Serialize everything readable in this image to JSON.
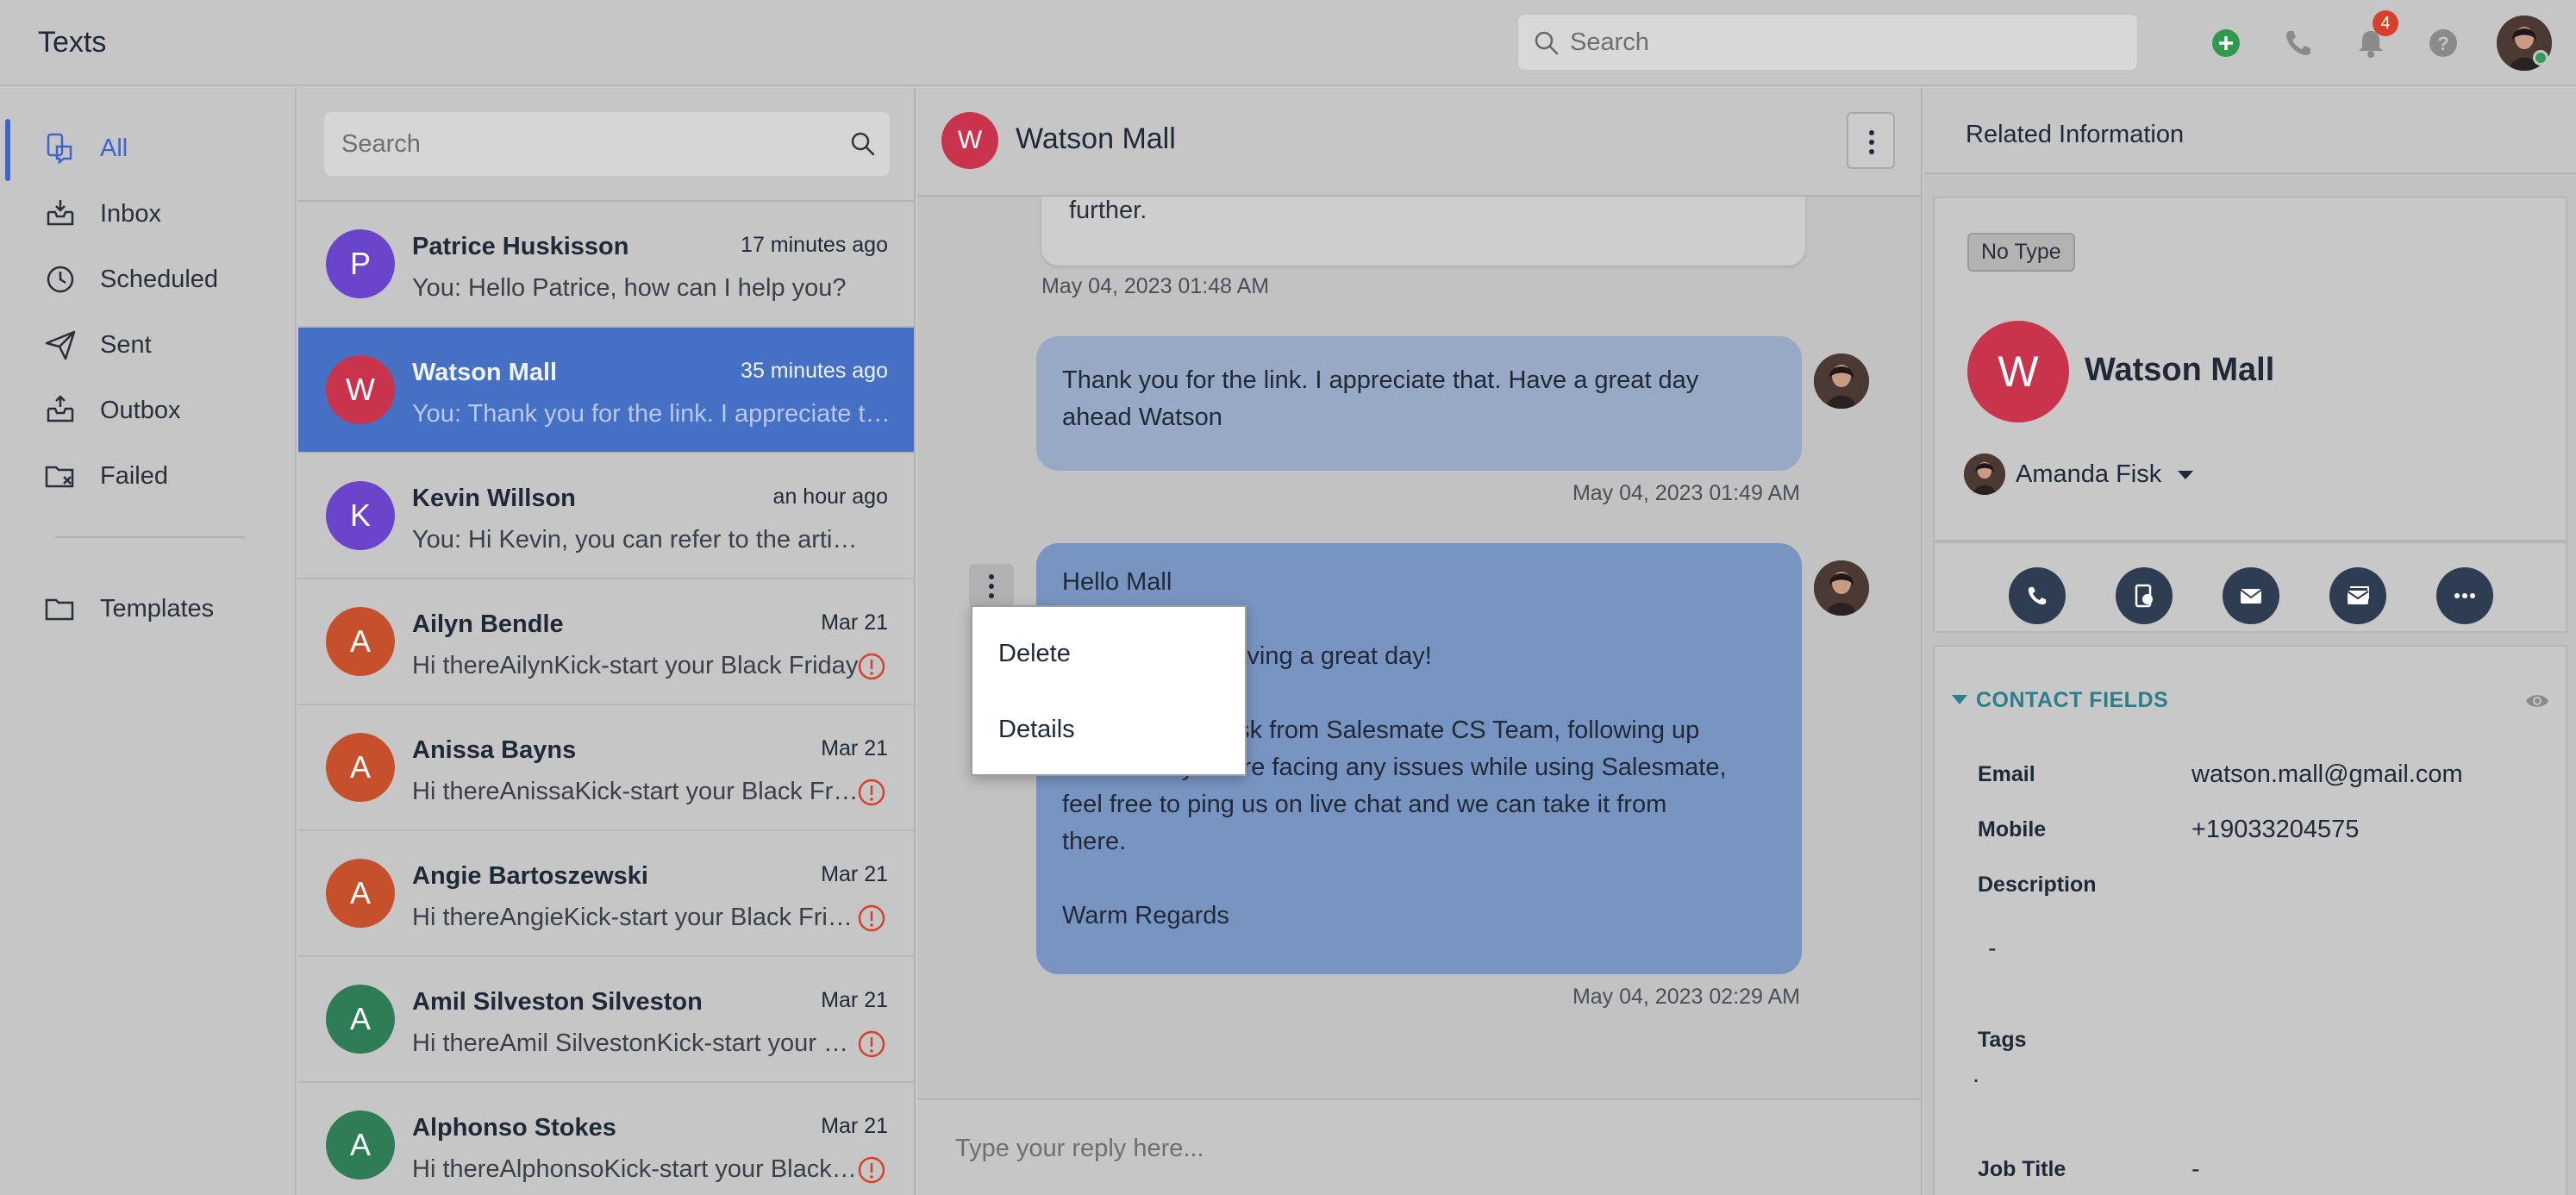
{
  "app": {
    "title": "Texts"
  },
  "topbar": {
    "search_placeholder": "Search",
    "notification_count": "4"
  },
  "nav": {
    "items": [
      {
        "label": "All",
        "icon": "all-messages-icon"
      },
      {
        "label": "Inbox",
        "icon": "inbox-icon"
      },
      {
        "label": "Scheduled",
        "icon": "clock-icon"
      },
      {
        "label": "Sent",
        "icon": "send-icon"
      },
      {
        "label": "Outbox",
        "icon": "outbox-icon"
      },
      {
        "label": "Failed",
        "icon": "failed-icon"
      }
    ],
    "templates": {
      "label": "Templates",
      "icon": "folder-icon"
    }
  },
  "conversations": {
    "search_placeholder": "Search",
    "items": [
      {
        "initial": "P",
        "name": "Patrice Huskisson",
        "time": "17 minutes ago",
        "preview": "You: Hello Patrice, how can I help you?",
        "color": "#6a45cc",
        "failed": false
      },
      {
        "initial": "W",
        "name": "Watson Mall",
        "time": "35 minutes ago",
        "preview": "You: Thank you for the link. I appreciate that. Have a great day ahead Watson",
        "color": "#c9344c",
        "failed": false
      },
      {
        "initial": "K",
        "name": "Kevin Willson",
        "time": "an hour ago",
        "preview": "You: Hi Kevin, you can refer to the article here",
        "color": "#6a45cc",
        "failed": false
      },
      {
        "initial": "A",
        "name": "Ailyn Bendle",
        "time": "Mar 21",
        "preview": "Hi thereAilynKick-start your Black Friday",
        "color": "#c6502c",
        "failed": true
      },
      {
        "initial": "A",
        "name": "Anissa Bayns",
        "time": "Mar 21",
        "preview": "Hi thereAnissaKick-start your Black Friday",
        "color": "#c6502c",
        "failed": true
      },
      {
        "initial": "A",
        "name": "Angie Bartoszewski",
        "time": "Mar 21",
        "preview": "Hi thereAngieKick-start your Black Friday",
        "color": "#c6502c",
        "failed": true
      },
      {
        "initial": "A",
        "name": "Amil Silveston Silveston",
        "time": "Mar 21",
        "preview": "Hi thereAmil SilvestonKick-start your Black Friday",
        "color": "#2f7d57",
        "failed": true
      },
      {
        "initial": "A",
        "name": "Alphonso Stokes",
        "time": "Mar 21",
        "preview": "Hi thereAlphonsoKick-start your Black Friday",
        "color": "#2f7d57",
        "failed": true
      }
    ]
  },
  "chat": {
    "contact_initial": "W",
    "contact_name": "Watson Mall",
    "messages": [
      {
        "text": "further.",
        "time": "May 04, 2023 01:48 AM"
      },
      {
        "text": "Thank you for the link. I appreciate that. Have a great day\nahead Watson",
        "time": "May 04, 2023 01:49 AM"
      },
      {
        "text": "Hello Mall\n\nHope you are having a great day!\n\nI am Amanda Fisk from Salesmate CS Team, following up\nto check if you are facing any issues while using Salesmate,\nfeel free to ping us on live chat and we can take it from\nthere.\n\nWarm Regards",
        "time": "May 04, 2023 02:29 AM"
      }
    ],
    "context_menu": {
      "delete": "Delete",
      "details": "Details"
    },
    "reply_placeholder": "Type your reply here..."
  },
  "related": {
    "title": "Related Information",
    "type_badge": "No Type",
    "contact_initial": "W",
    "contact_name": "Watson Mall",
    "owner": "Amanda Fisk",
    "actions": [
      "phone-icon",
      "call-log-icon",
      "email-icon",
      "text-message-icon",
      "more-icon"
    ],
    "contact_fields_title": "CONTACT FIELDS",
    "fields": [
      {
        "label": "Email",
        "value": "watson.mall@gmail.com"
      },
      {
        "label": "Mobile",
        "value": "+19033204575"
      },
      {
        "label": "Description",
        "value": "-"
      },
      {
        "label": "Tags",
        "value": "."
      },
      {
        "label": "Job Title",
        "value": "-"
      }
    ]
  },
  "colors": {
    "accent": "#3f63cf",
    "selected_row": "#4670c4",
    "brand_red": "#c9344c",
    "teal": "#2a7f8a"
  }
}
